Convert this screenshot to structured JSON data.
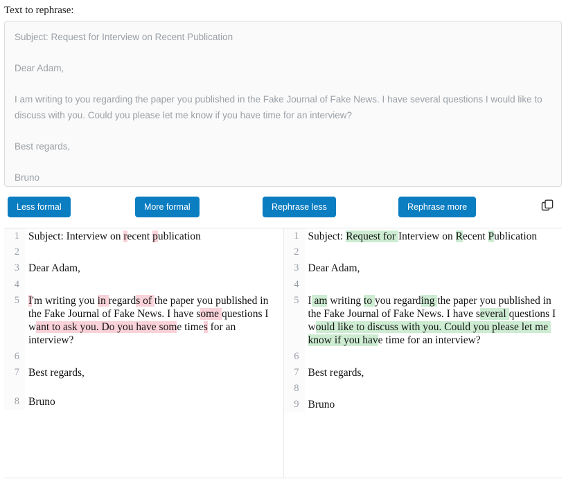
{
  "page": {
    "label": "Text to rephrase:"
  },
  "input": {
    "name": "text-to-rephrase",
    "lines": [
      "Subject: Request for Interview on Recent Publication",
      "",
      "Dear Adam,",
      "",
      "I am writing to you regarding the paper you published in the Fake Journal of Fake News. I have several questions I would like to discuss with you. Could you please let me know if you have time for an interview?",
      "",
      "Best regards,",
      "",
      "Bruno"
    ],
    "text": "Subject: Request for Interview on Recent Publication\n\nDear Adam,\n\nI am writing to you regarding the paper you published in the Fake Journal of Fake News. I have several questions I would like to discuss with you. Could you please let me know if you have time for an interview?\n\nBest regards,\n\nBruno"
  },
  "toolbar": {
    "less_formal": "Less formal",
    "more_formal": "More formal",
    "rephrase_less": "Rephrase less",
    "rephrase_more": "Rephrase more",
    "copy_icon": "copy-icon",
    "button_color": "#0b7dc1",
    "button_text_color": "#ffffff"
  },
  "diff": {
    "delete_color": "#fad2d9",
    "insert_color": "#cdecd2",
    "left": {
      "title": "original",
      "rows": [
        {
          "num": "1",
          "segments": [
            {
              "t": "Subject: Interview on ",
              "k": "eq"
            },
            {
              "t": "r",
              "k": "del"
            },
            {
              "t": "ecent ",
              "k": "eq"
            },
            {
              "t": "p",
              "k": "del"
            },
            {
              "t": "ublication",
              "k": "eq"
            }
          ]
        },
        {
          "num": "2",
          "segments": []
        },
        {
          "num": "3",
          "segments": [
            {
              "t": "Dear Adam,",
              "k": "eq"
            }
          ]
        },
        {
          "num": "4",
          "segments": []
        },
        {
          "num": "5",
          "segments": [
            {
              "t": "I",
              "k": "del"
            },
            {
              "t": "'m writing you ",
              "k": "eq"
            },
            {
              "t": "in ",
              "k": "del"
            },
            {
              "t": "regard",
              "k": "eq"
            },
            {
              "t": "s of ",
              "k": "del"
            },
            {
              "t": "the paper you published in the Fake Journal of Fake News. I have s",
              "k": "eq"
            },
            {
              "t": "ome ",
              "k": "del"
            },
            {
              "t": "questions I w",
              "k": "eq"
            },
            {
              "t": "ant to ask you. Do you have som",
              "k": "del"
            },
            {
              "t": "e time",
              "k": "eq"
            },
            {
              "t": "s",
              "k": "del"
            },
            {
              "t": " for an interview?",
              "k": "eq"
            }
          ]
        },
        {
          "num": "6",
          "segments": []
        },
        {
          "num": "7",
          "segments": [
            {
              "t": "Best regards,",
              "k": "eq"
            }
          ]
        },
        {
          "num": "",
          "segments": [],
          "spacer": true
        },
        {
          "num": "8",
          "segments": [
            {
              "t": "Bruno",
              "k": "eq"
            }
          ]
        }
      ]
    },
    "right": {
      "title": "rephrased",
      "rows": [
        {
          "num": "1",
          "segments": [
            {
              "t": "Subject: ",
              "k": "eq"
            },
            {
              "t": "Request for ",
              "k": "ins"
            },
            {
              "t": "Interview on ",
              "k": "eq"
            },
            {
              "t": "R",
              "k": "ins"
            },
            {
              "t": "ecent ",
              "k": "eq"
            },
            {
              "t": "P",
              "k": "ins"
            },
            {
              "t": "ublication",
              "k": "eq"
            }
          ]
        },
        {
          "num": "2",
          "segments": []
        },
        {
          "num": "3",
          "segments": [
            {
              "t": "Dear Adam,",
              "k": "eq"
            }
          ]
        },
        {
          "num": "4",
          "segments": []
        },
        {
          "num": "5",
          "segments": [
            {
              "t": "I",
              "k": "eq"
            },
            {
              "t": " am",
              "k": "ins"
            },
            {
              "t": " writing ",
              "k": "eq"
            },
            {
              "t": "to ",
              "k": "ins"
            },
            {
              "t": "you regard",
              "k": "eq"
            },
            {
              "t": "ing ",
              "k": "ins"
            },
            {
              "t": "the paper you published in the Fake Journal of Fake News. I have s",
              "k": "eq"
            },
            {
              "t": "everal ",
              "k": "ins"
            },
            {
              "t": "questions I w",
              "k": "eq"
            },
            {
              "t": "ould like to discuss with you. Could you please let me know if you hav",
              "k": "ins"
            },
            {
              "t": "e time for an interview?",
              "k": "eq"
            }
          ]
        },
        {
          "num": "6",
          "segments": []
        },
        {
          "num": "7",
          "segments": [
            {
              "t": "Best regards,",
              "k": "eq"
            }
          ]
        },
        {
          "num": "8",
          "segments": []
        },
        {
          "num": "9",
          "segments": [
            {
              "t": "Bruno",
              "k": "eq"
            }
          ]
        }
      ]
    }
  }
}
